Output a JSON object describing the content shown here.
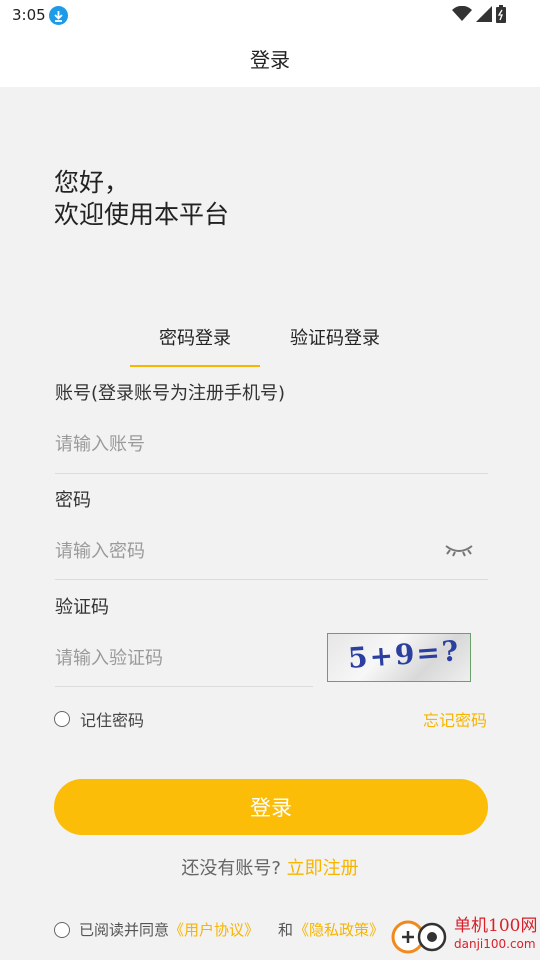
{
  "status": {
    "time": "3:05"
  },
  "appbar": {
    "title": "登录"
  },
  "greeting": {
    "line1": "您好，",
    "line2": "欢迎使用本平台"
  },
  "tabs": [
    {
      "label": "密码登录",
      "active": true
    },
    {
      "label": "验证码登录",
      "active": false
    }
  ],
  "form": {
    "account_label": "账号(登录账号为注册手机号)",
    "account_placeholder": "请输入账号",
    "password_label": "密码",
    "password_placeholder": "请输入密码",
    "captcha_label": "验证码",
    "captcha_placeholder": "请输入验证码",
    "captcha_image_text": "5+9=?",
    "remember_label": "记住密码",
    "forgot_label": "忘记密码",
    "login_label": "登录"
  },
  "register": {
    "prompt": "还没有账号?",
    "link": "立即注册"
  },
  "agreement": {
    "prefix": "已阅读并同意",
    "user_agreement": "《用户协议》",
    "and": "和",
    "privacy_policy": "《隐私政策》"
  },
  "watermark": {
    "name": "单机100网",
    "url": "danji100.com"
  },
  "colors": {
    "accent": "#fbbd08",
    "link": "#f7b500",
    "background": "#f2f2f2"
  },
  "icons": [
    "download-badge-icon",
    "wifi-icon",
    "signal-icon",
    "battery-icon",
    "eye-closed-icon"
  ]
}
